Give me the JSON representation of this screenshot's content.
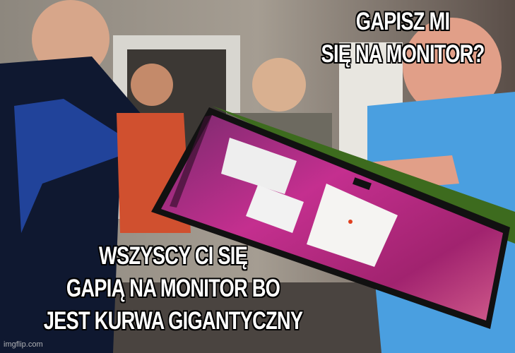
{
  "meme": {
    "top_caption": [
      "GAPISZ MI",
      "SIĘ NA MONITOR?"
    ],
    "bottom_caption": [
      "WSZYSCY CI SIĘ",
      "GAPIĄ NA MONITOR BO",
      "JEST KURWA GIGANTYCZNY"
    ],
    "watermark": "imgflip.com"
  },
  "colors": {
    "wallpaper": "#b0277f",
    "bezel": "#111111",
    "monitor_back": "#3d6b1e",
    "shirt_blue": "#4a9fe0"
  }
}
